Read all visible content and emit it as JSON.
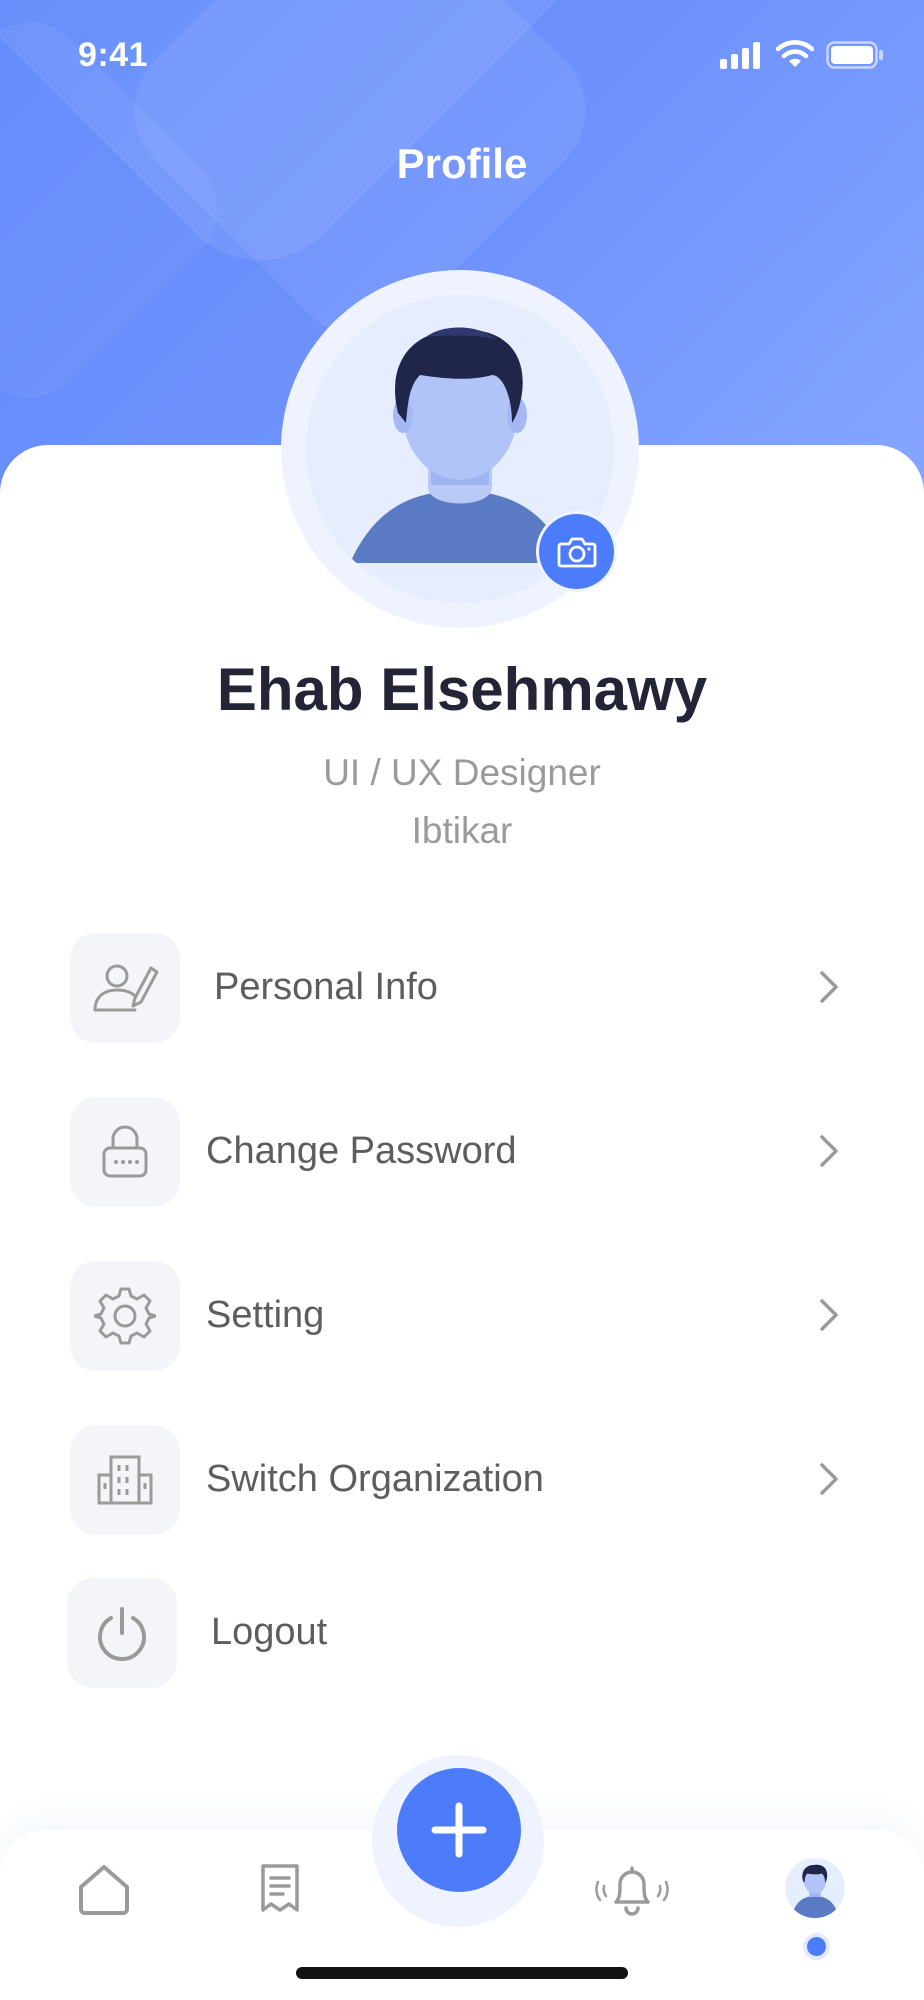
{
  "status_bar": {
    "time": "9:41"
  },
  "header": {
    "title": "Profile"
  },
  "profile": {
    "name": "Ehab Elsehmawy",
    "role": "UI / UX Designer",
    "organization": "Ibtikar"
  },
  "menu": {
    "items": [
      {
        "label": "Personal Info",
        "icon": "user-edit-icon"
      },
      {
        "label": "Change Password",
        "icon": "lock-icon"
      },
      {
        "label": "Setting",
        "icon": "gear-icon"
      },
      {
        "label": "Switch Organization",
        "icon": "building-icon"
      },
      {
        "label": "Logout",
        "icon": "power-icon"
      }
    ]
  },
  "bottom_nav": {
    "items": [
      "home-icon",
      "receipt-icon",
      "add-icon",
      "bell-icon",
      "profile-avatar"
    ],
    "active": "profile-avatar"
  },
  "colors": {
    "accent": "#4d7cfa",
    "header_gradient_start": "#5b86fb",
    "header_gradient_end": "#86a6ff",
    "name_text": "#232537",
    "subtitle_text": "#9a9a9a",
    "menu_text": "#5d5d5d",
    "icon_tile": "#f4f5f9"
  }
}
